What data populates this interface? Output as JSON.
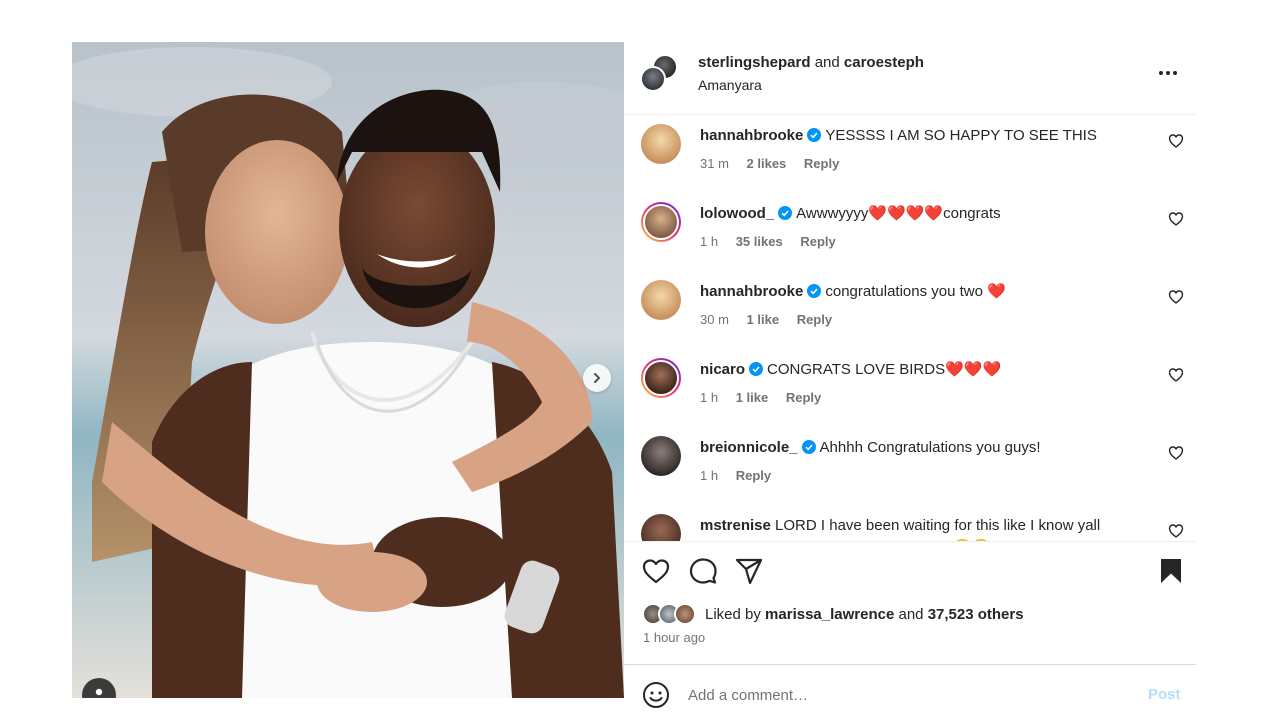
{
  "post": {
    "author_1": "sterlingshepard",
    "conjunction": "and",
    "author_2": "caroesteph",
    "location": "Amanyara",
    "more_icon": "more-horizontal-icon"
  },
  "comments": [
    {
      "user": "hannahbrooke",
      "verified": true,
      "text": "YESSSS I AM SO HAPPY TO SEE THIS",
      "time": "31 m",
      "likes": "2 likes",
      "reply": "Reply"
    },
    {
      "user": "lolowood_",
      "verified": true,
      "text": "Awwwyyyy❤️❤️❤️❤️congrats",
      "time": "1 h",
      "likes": "35 likes",
      "reply": "Reply"
    },
    {
      "user": "hannahbrooke",
      "verified": true,
      "text": "congratulations you two ❤️",
      "time": "30 m",
      "likes": "1 like",
      "reply": "Reply"
    },
    {
      "user": "nicaro",
      "verified": true,
      "text": "CONGRATS LOVE BIRDS❤️❤️❤️",
      "time": "1 h",
      "likes": "1 like",
      "reply": "Reply"
    },
    {
      "user": "breionnicole_",
      "verified": true,
      "text": "Ahhhh Congratulations you guys!",
      "time": "1 h",
      "likes": "",
      "reply": "Reply"
    },
    {
      "user": "mstrenise",
      "verified": false,
      "text": "LORD I have been waiting for this like I know yall personally and I'm apart of the family! 😭😭 I have enjoyed",
      "time": "",
      "likes": "",
      "reply": ""
    }
  ],
  "likes": {
    "prefix": "Liked by",
    "user": "marissa_lawrence",
    "middle": "and",
    "count": "37,523 others"
  },
  "timestamp": "1 hour ago",
  "add_comment": {
    "placeholder": "Add a comment…",
    "post_label": "Post"
  },
  "colors": {
    "verified_blue": "#0095f6",
    "text": "#262626",
    "muted": "#737373",
    "post_button_disabled": "#b2dffc"
  }
}
